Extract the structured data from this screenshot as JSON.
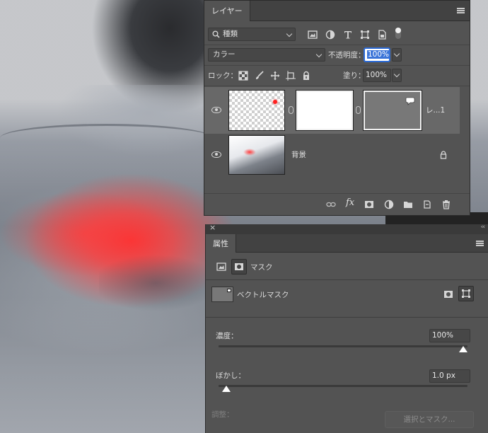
{
  "layers_panel": {
    "tab_label": "レイヤー",
    "filter_dropdown": "種類",
    "blend_mode": "カラー",
    "opacity_label": "不透明度：",
    "opacity_value": "100%",
    "lock_label": "ロック：",
    "fill_label": "塗り：",
    "fill_value": "100%",
    "layers": [
      {
        "name": "レ...1",
        "visible": true,
        "selected": true
      },
      {
        "name": "背景",
        "visible": true,
        "locked": true
      }
    ]
  },
  "properties_panel": {
    "tab_label": "属性",
    "mask_section_label": "マスク",
    "vector_mask_label": "ベクトルマスク",
    "density_label": "濃度：",
    "density_value": "100%",
    "density_fraction": 1.0,
    "feather_label": "ぼかし：",
    "feather_value": "1.0 px",
    "feather_fraction": 0.0,
    "refine_label": "調整：",
    "select_mask_button": "選択とマスク..."
  },
  "colors": {
    "panel_bg": "#535353",
    "tab_bg": "#424242",
    "selected_row": "#686868",
    "highlight_blue": "#3b74d8",
    "photo_red": "#ff3c3c"
  }
}
